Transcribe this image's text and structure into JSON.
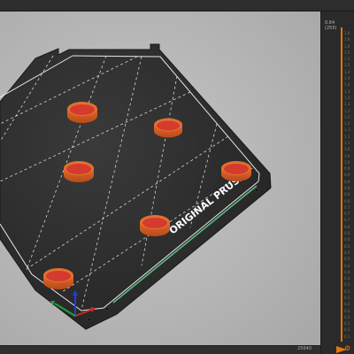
{
  "bed": {
    "brand_text": "ORIGINAL PRUSA"
  },
  "layer_slider": {
    "top_value": "0.64",
    "top_index": "(255)",
    "tick_labels": [
      "1.6",
      "1.6",
      "1.6",
      "1.5",
      "1.5",
      "1.5",
      "1.4",
      "1.4",
      "1.4",
      "1.3",
      "1.3",
      "1.3",
      "1.2",
      "1.2",
      "1.2",
      "1.1",
      "1.1",
      "1.1",
      "1.0",
      "1.0",
      "1.0",
      "0.9",
      "0.9",
      "0.9",
      "0.8",
      "0.8",
      "0.8",
      "0.7",
      "0.7",
      "0.7",
      "0.6",
      "0.6",
      "0.6",
      "0.5",
      "0.5",
      "0.5",
      "0.4",
      "0.4",
      "0.4",
      "0.3",
      "0.3",
      "0.3",
      "0.2",
      "0.2",
      "0.2",
      "0.1",
      "0.1",
      "0.1"
    ]
  },
  "move_slider": {
    "right_value": "25640"
  },
  "colors": {
    "accent": "#e8750a",
    "bed": "#303030",
    "object": "#d43a2e"
  }
}
